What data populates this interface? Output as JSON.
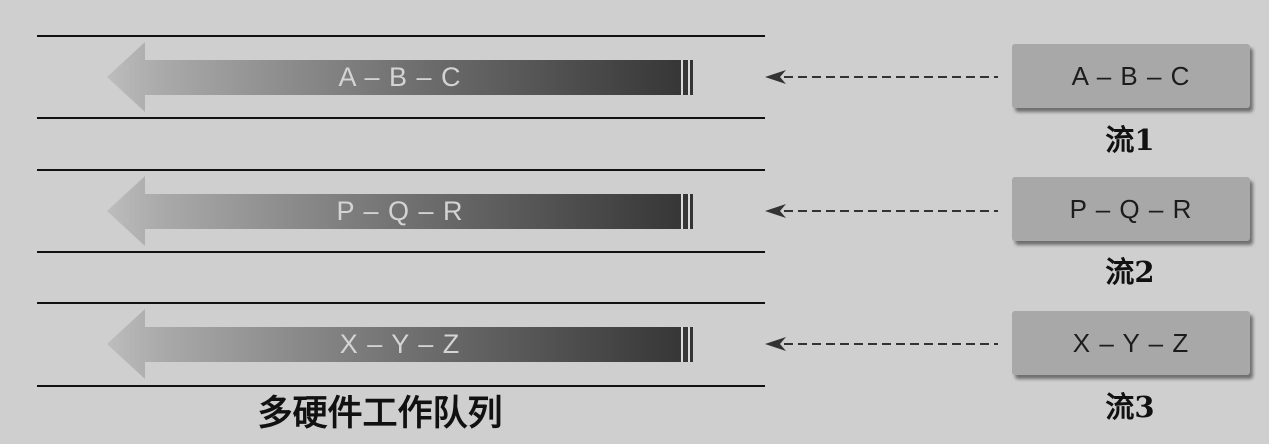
{
  "colors": {
    "background": "#cfcfcf",
    "lane_line": "#111111",
    "connector": "#333333",
    "arrow_light": "#bdbdbd",
    "arrow_dark": "#343434",
    "arrow_text": "#d4d4d4",
    "stream_box": "#a8a8a8",
    "stream_box_shadow": "#6f6f6f"
  },
  "queue_caption": "多硬件工作队列",
  "lanes": [
    {
      "queue_content": "A – B – C",
      "stream_content": "A – B – C",
      "stream_label": "流1"
    },
    {
      "queue_content": "P – Q – R",
      "stream_content": "P – Q – R",
      "stream_label": "流2"
    },
    {
      "queue_content": "X – Y – Z",
      "stream_content": "X – Y – Z",
      "stream_label": "流3"
    }
  ]
}
